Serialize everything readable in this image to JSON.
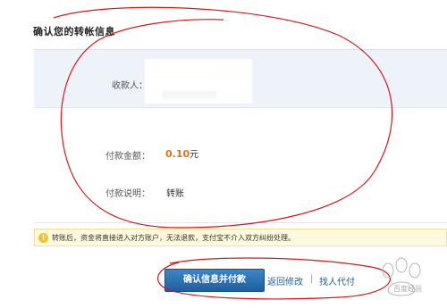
{
  "section_title": "确认您的转帐信息",
  "payee": {
    "label": "收款人："
  },
  "amount": {
    "label": "付款金额：",
    "value": "0.10",
    "unit": "元"
  },
  "note": {
    "label": "付款说明：",
    "value": "转账"
  },
  "notice": {
    "icon": "info-icon",
    "icon_glyph": "!",
    "text": "转账后，资金将直接进入对方账户，无法退款，支付宝不介入双方纠纷处理。"
  },
  "actions": {
    "confirm_label": "确认信息并付款",
    "back_label": "返回修改",
    "separator": "|",
    "other_label": "找人代付"
  },
  "watermark": {
    "text": "百度经验"
  },
  "colors": {
    "accent_orange": "#e4711b",
    "button_blue": "#2a6fb0",
    "link_blue": "#1c5fa6",
    "notice_bg": "#fff9dd",
    "annotation_red": "#d11a1a"
  }
}
